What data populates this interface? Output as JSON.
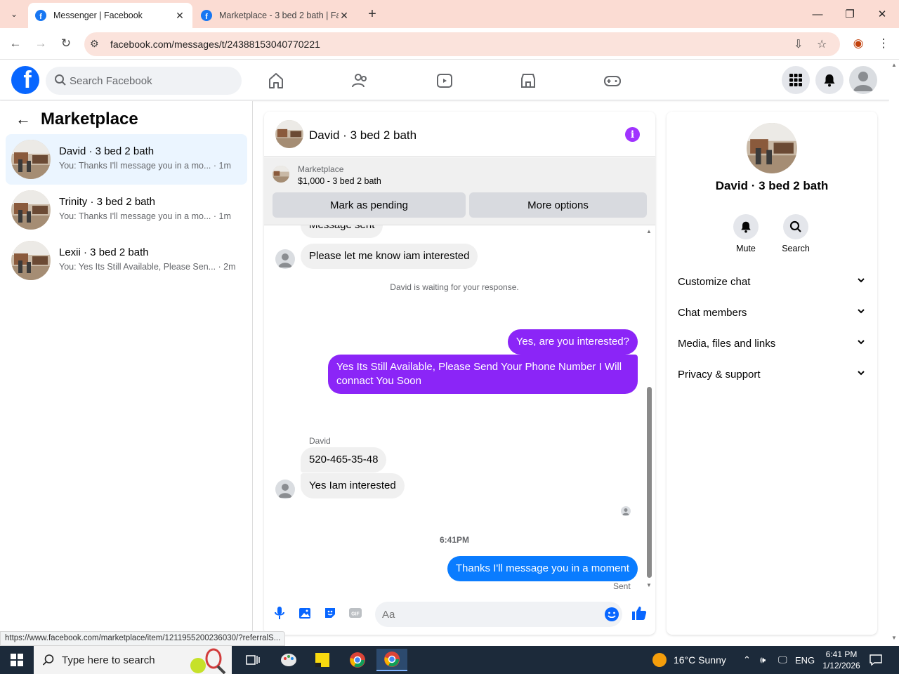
{
  "browser": {
    "tabs": [
      {
        "title": "Messenger | Facebook",
        "active": true
      },
      {
        "title": "Marketplace - 3 bed 2 bath | Fa",
        "active": false
      }
    ],
    "url": "facebook.com/messages/t/24388153040770221",
    "status_url": "https://www.facebook.com/marketplace/item/1211955200236030/?referralS..."
  },
  "fb_header": {
    "search_placeholder": "Search Facebook"
  },
  "sidebar": {
    "title": "Marketplace",
    "conversations": [
      {
        "name": "David · 3 bed 2 bath",
        "preview": "You: Thanks I'll message you in a mo... · 1m",
        "active": true
      },
      {
        "name": "Trinity · 3 bed 2 bath",
        "preview": "You: Thanks I'll message you in a mo... · 1m",
        "active": false
      },
      {
        "name": "Lexii · 3 bed 2 bath",
        "preview": "You: Yes Its Still Available, Please Sen... · 2m",
        "active": false
      }
    ]
  },
  "chat": {
    "title": "David · 3 bed 2 bath",
    "marketplace_label": "Marketplace",
    "listing": "$1,000 - 3 bed 2 bath",
    "mark_pending": "Mark as pending",
    "more_options": "More options",
    "messages": {
      "m0": "Message sent",
      "m1": "Please let me know iam interested",
      "waiting": "David is waiting for your response.",
      "m2": "Yes, are you interested?",
      "m3": "Yes Its Still Available, Please Send Your Phone Number I Will connact You Soon",
      "sender": "David",
      "m4": "520-465-35-48",
      "m5": "Yes Iam interested",
      "time": "6:41PM",
      "m6": "Thanks I'll message you in a moment",
      "sent": "Sent"
    },
    "composer_placeholder": "Aa"
  },
  "right_panel": {
    "title": "David · 3 bed 2 bath",
    "mute": "Mute",
    "search": "Search",
    "sections": [
      "Customize chat",
      "Chat members",
      "Media, files and links",
      "Privacy & support"
    ]
  },
  "taskbar": {
    "search_text": "Type here to search",
    "weather": "16°C  Sunny",
    "lang": "ENG",
    "time": "6:41 PM",
    "date": "1/12/2026"
  },
  "colors": {
    "fb_blue": "#0866ff",
    "outgoing_purple": "#8b25f7",
    "outgoing_blue": "#0a7cff",
    "info_purple": "#a033ff"
  }
}
